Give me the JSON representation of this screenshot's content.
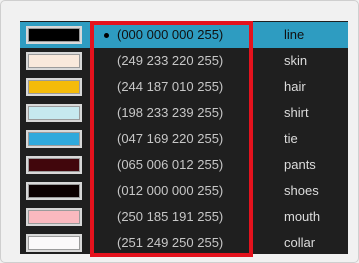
{
  "colors": {
    "accent": "#2e9cc1",
    "highlight": "#e4121d",
    "panel": "#1f1f1f"
  },
  "palette": {
    "rows": [
      {
        "rgba": "(000 000 000 255)",
        "name": "line",
        "swatch": "#000000",
        "selected": true
      },
      {
        "rgba": "(249 233 220 255)",
        "name": "skin",
        "swatch": "#f9e9dc",
        "selected": false
      },
      {
        "rgba": "(244 187 010 255)",
        "name": "hair",
        "swatch": "#f4bb0a",
        "selected": false
      },
      {
        "rgba": "(198 233 239 255)",
        "name": "shirt",
        "swatch": "#c6e9ef",
        "selected": false
      },
      {
        "rgba": "(047 169 220 255)",
        "name": "tie",
        "swatch": "#2fa9dc",
        "selected": false
      },
      {
        "rgba": "(065 006 012 255)",
        "name": "pants",
        "swatch": "#41060c",
        "selected": false
      },
      {
        "rgba": "(012 000 000 255)",
        "name": "shoes",
        "swatch": "#0c0000",
        "selected": false
      },
      {
        "rgba": "(250 185 191 255)",
        "name": "mouth",
        "swatch": "#fab9bf",
        "selected": false
      },
      {
        "rgba": "(251 249 250 255)",
        "name": "collar",
        "swatch": "#fbf9fa",
        "selected": false
      }
    ]
  }
}
